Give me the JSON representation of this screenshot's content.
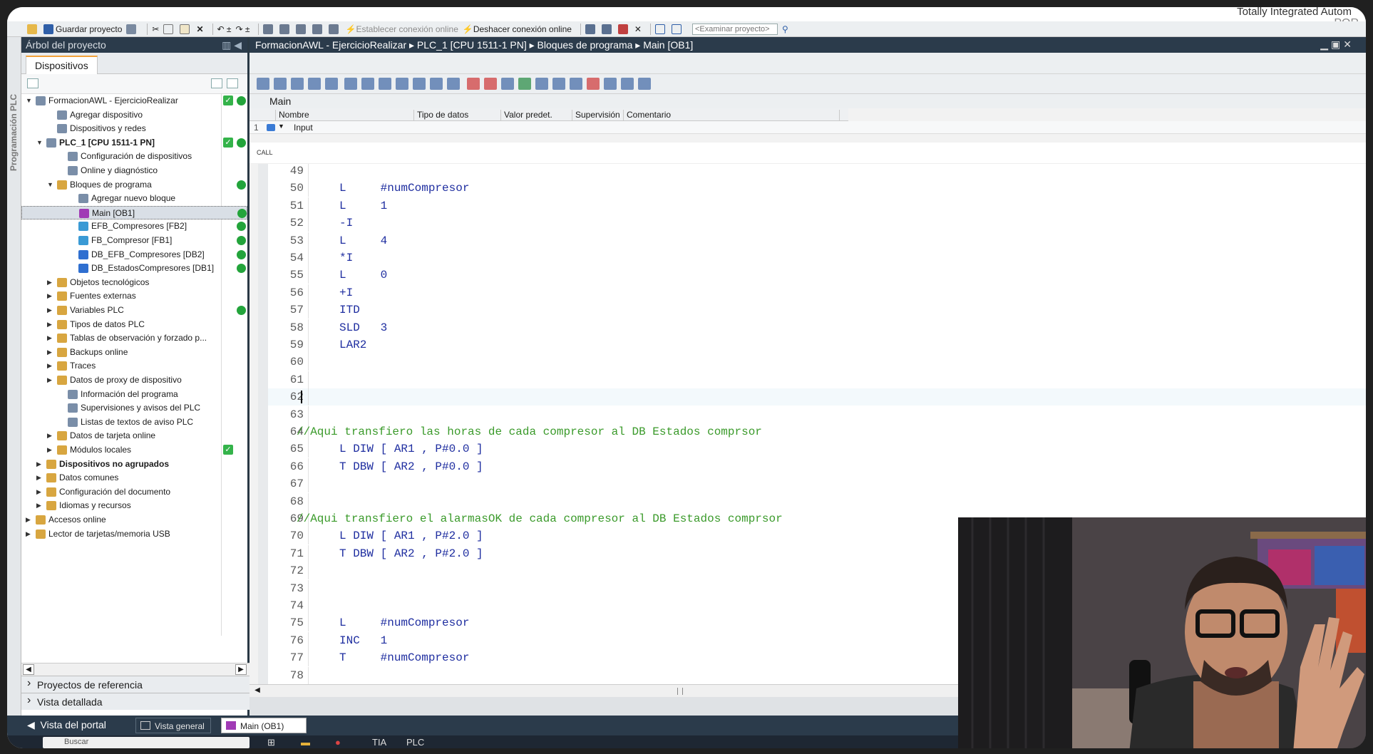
{
  "brand": {
    "line1": "Totally Integrated Autom",
    "line2": "POR"
  },
  "toolbar": {
    "save_label": "Guardar proyecto",
    "connect_label": "Establecer conexión online",
    "disconnect_label": "Deshacer conexión online",
    "search_placeholder": "<Examinar proyecto>"
  },
  "left_panel": {
    "vertical_tab": "Programación PLC",
    "title": "Árbol del proyecto",
    "devices_tab": "Dispositivos",
    "tree": [
      {
        "label": "FormacionAWL - EjercicioRealizar",
        "indent": 0,
        "exp": "▼",
        "check": true,
        "dot": true
      },
      {
        "label": "Agregar dispositivo",
        "indent": 2
      },
      {
        "label": "Dispositivos y redes",
        "indent": 2
      },
      {
        "label": "PLC_1 [CPU 1511-1 PN]",
        "indent": 1,
        "exp": "▼",
        "check": true,
        "dot": true,
        "bold": true
      },
      {
        "label": "Configuración de dispositivos",
        "indent": 3
      },
      {
        "label": "Online y diagnóstico",
        "indent": 3
      },
      {
        "label": "Bloques de programa",
        "indent": 2,
        "exp": "▼",
        "dot": true
      },
      {
        "label": "Agregar nuevo bloque",
        "indent": 4
      },
      {
        "label": "Main [OB1]",
        "indent": 4,
        "dot": true,
        "sel": true
      },
      {
        "label": "EFB_Compresores [FB2]",
        "indent": 4,
        "dot": true
      },
      {
        "label": "FB_Compresor [FB1]",
        "indent": 4,
        "dot": true
      },
      {
        "label": "DB_EFB_Compresores [DB2]",
        "indent": 4,
        "dot": true
      },
      {
        "label": "DB_EstadosCompresores [DB1]",
        "indent": 4,
        "dot": true
      },
      {
        "label": "Objetos tecnológicos",
        "indent": 2,
        "exp": "▶"
      },
      {
        "label": "Fuentes externas",
        "indent": 2,
        "exp": "▶"
      },
      {
        "label": "Variables PLC",
        "indent": 2,
        "exp": "▶",
        "dot": true
      },
      {
        "label": "Tipos de datos PLC",
        "indent": 2,
        "exp": "▶"
      },
      {
        "label": "Tablas de observación y forzado p...",
        "indent": 2,
        "exp": "▶"
      },
      {
        "label": "Backups online",
        "indent": 2,
        "exp": "▶"
      },
      {
        "label": "Traces",
        "indent": 2,
        "exp": "▶"
      },
      {
        "label": "Datos de proxy de dispositivo",
        "indent": 2,
        "exp": "▶"
      },
      {
        "label": "Información del programa",
        "indent": 3
      },
      {
        "label": "Supervisiones y avisos del PLC",
        "indent": 3
      },
      {
        "label": "Listas de textos de aviso PLC",
        "indent": 3
      },
      {
        "label": "Datos de tarjeta online",
        "indent": 2,
        "exp": "▶"
      },
      {
        "label": "Módulos locales",
        "indent": 2,
        "exp": "▶",
        "check": true
      },
      {
        "label": "Dispositivos no agrupados",
        "indent": 1,
        "exp": "▶",
        "bold": true
      },
      {
        "label": "Datos comunes",
        "indent": 1,
        "exp": "▶"
      },
      {
        "label": "Configuración del documento",
        "indent": 1,
        "exp": "▶"
      },
      {
        "label": "Idiomas y recursos",
        "indent": 1,
        "exp": "▶"
      },
      {
        "label": "Accesos online",
        "indent": 0,
        "exp": "▶"
      },
      {
        "label": "Lector de tarjetas/memoria USB",
        "indent": 0,
        "exp": "▶"
      }
    ],
    "footer_ref": "Proyectos de referencia",
    "footer_detail": "Vista detallada"
  },
  "editor": {
    "breadcrumb": "FormacionAWL - EjercicioRealizar  ▸  PLC_1 [CPU 1511-1 PN]  ▸  Bloques de programa  ▸  Main [OB1]",
    "block_name": "Main",
    "columns": [
      "Nombre",
      "Tipo de datos",
      "Valor predet.",
      "Supervisión",
      "Comentario"
    ],
    "interface_row": {
      "num": "1",
      "name": "Input"
    },
    "call_label": "CALL",
    "lines": [
      {
        "n": "49",
        "t": ""
      },
      {
        "n": "50",
        "t": "L     #numCompresor"
      },
      {
        "n": "51",
        "t": "L     1"
      },
      {
        "n": "52",
        "t": "-I"
      },
      {
        "n": "53",
        "t": "L     4"
      },
      {
        "n": "54",
        "t": "*I"
      },
      {
        "n": "55",
        "t": "L     0"
      },
      {
        "n": "56",
        "t": "+I"
      },
      {
        "n": "57",
        "t": "ITD"
      },
      {
        "n": "58",
        "t": "SLD   3"
      },
      {
        "n": "59",
        "t": "LAR2"
      },
      {
        "n": "60",
        "t": ""
      },
      {
        "n": "61",
        "t": ""
      },
      {
        "n": "62",
        "t": "",
        "cursor": true
      },
      {
        "n": "63",
        "t": ""
      },
      {
        "n": "64",
        "c": "//Aqui transfiero las horas de cada compresor al DB Estados comprsor"
      },
      {
        "n": "65",
        "t": "L DIW [ AR1 , P#0.0 ]"
      },
      {
        "n": "66",
        "t": "T DBW [ AR2 , P#0.0 ]"
      },
      {
        "n": "67",
        "t": ""
      },
      {
        "n": "68",
        "t": ""
      },
      {
        "n": "69",
        "c": "//Aqui transfiero el alarmasOK de cada compresor al DB Estados comprsor"
      },
      {
        "n": "70",
        "t": "L DIW [ AR1 , P#2.0 ]"
      },
      {
        "n": "71",
        "t": "T DBW [ AR2 , P#2.0 ]"
      },
      {
        "n": "72",
        "t": ""
      },
      {
        "n": "73",
        "t": ""
      },
      {
        "n": "74",
        "t": ""
      },
      {
        "n": "75",
        "t": "L     #numCompresor"
      },
      {
        "n": "76",
        "t": "INC   1"
      },
      {
        "n": "77",
        "t": "T     #numCompresor"
      },
      {
        "n": "78",
        "t": ""
      }
    ]
  },
  "portal": {
    "view_label": "Vista del portal",
    "tab_overview": "Vista general",
    "tab_main": "Main (OB1)"
  },
  "taskbar": {
    "search": "Buscar",
    "app1": "TIA",
    "app2": "PLC"
  }
}
